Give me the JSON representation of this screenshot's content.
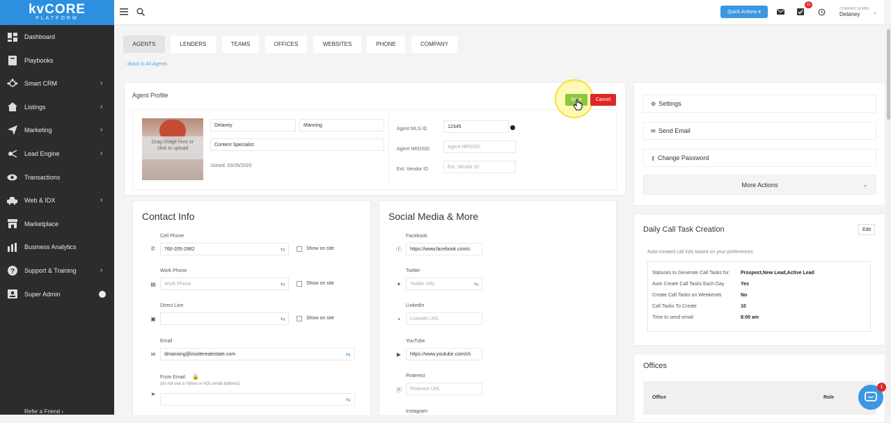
{
  "brand": {
    "line1": "kvCORE",
    "line2": "PLATFORM"
  },
  "sidebar": {
    "items": [
      {
        "label": "Dashboard",
        "icon": "dashboard-icon",
        "chevron": false
      },
      {
        "label": "Playbooks",
        "icon": "book-icon",
        "chevron": false
      },
      {
        "label": "Smart CRM",
        "icon": "crm-icon",
        "chevron": true
      },
      {
        "label": "Listings",
        "icon": "home-icon",
        "chevron": true
      },
      {
        "label": "Marketing",
        "icon": "paper-plane-icon",
        "chevron": true
      },
      {
        "label": "Lead Engine",
        "icon": "lead-engine-icon",
        "chevron": true
      },
      {
        "label": "Transactions",
        "icon": "eye-icon",
        "chevron": false
      },
      {
        "label": "Web & IDX",
        "icon": "car-icon",
        "chevron": true
      },
      {
        "label": "Marketplace",
        "icon": "store-icon",
        "chevron": false
      },
      {
        "label": "Business Analytics",
        "icon": "bar-chart-icon",
        "chevron": false
      },
      {
        "label": "Support & Training",
        "icon": "help-icon",
        "chevron": true
      },
      {
        "label": "Super Admin",
        "icon": "user-card-icon",
        "chevron": false
      }
    ],
    "refer": "Refer a Friend ›"
  },
  "topbar": {
    "quick_actions": "Quick Actions ▾",
    "notif_count": "11",
    "company_label": "COMPANY ADMIN",
    "user": "Delaney"
  },
  "tabs": [
    "AGENTS",
    "LENDERS",
    "TEAMS",
    "OFFICES",
    "WEBSITES",
    "PHONE",
    "COMPANY"
  ],
  "back_link": "‹ Back to All Agents",
  "profile": {
    "title": "Agent Profile",
    "save": "Save",
    "cancel": "Cancel",
    "drag_text": "Drag image here or click to upload",
    "first_name": "Delaney",
    "last_name": "Manning",
    "job_title": "Content Specialist",
    "joined": "Joined: 03/26/2020",
    "mls_label": "Agent MLS ID",
    "mls_value": "12345",
    "nrdsid_label": "Agent NRDSID",
    "nrdsid_placeholder": "Agent NRDSID",
    "vendor_label": "Ext. Vendor ID",
    "vendor_placeholder": "Ext. Vendor ID"
  },
  "contact": {
    "title": "Contact Info",
    "cell_label": "Cell Phone",
    "cell_value": "760-205-2982",
    "work_label": "Work Phone",
    "work_placeholder": "Work Phone",
    "direct_label": "Direct Line",
    "direct_value": "",
    "email_label": "Email",
    "email_value": "dmanning@insiderealestate.com",
    "from_label": "From Email:",
    "from_note": "(do not use a Yahoo or AOL email address)",
    "show_on_site": "Show on site"
  },
  "social": {
    "title": "Social Media & More",
    "facebook_label": "Facebook",
    "facebook_value": "https://www.facebook.com/c",
    "twitter_label": "Twitter",
    "twitter_placeholder": "Twitter URL",
    "linkedin_label": "LinkedIn",
    "linkedin_placeholder": "Linkedin URL",
    "youtube_label": "YouTube",
    "youtube_value": "https://www.youtube.com/ch",
    "pinterest_label": "Pinterest",
    "pinterest_placeholder": "Pinterest URL",
    "instagram_label": "Instagram"
  },
  "actions": {
    "settings": "Settings",
    "send_email": "Send Email",
    "change_password": "Change Password",
    "more_actions": "More Actions"
  },
  "daily_call": {
    "title": "Daily Call Task Creation",
    "edit": "Edit",
    "subtitle": "Auto-created call lists based on your preferences.",
    "rows": [
      {
        "label": "Statuses to Generate Call Tasks for",
        "value": "Prospect,New Lead,Active Lead"
      },
      {
        "label": "Auto Create Call Tasks Each Day",
        "value": "Yes"
      },
      {
        "label": "Create Call Tasks on Weekends",
        "value": "No"
      },
      {
        "label": "Call Tasks To Create",
        "value": "10"
      },
      {
        "label": "Time to send email",
        "value": "8:00 am"
      }
    ]
  },
  "offices": {
    "title": "Offices",
    "col_office": "Office",
    "col_role": "Role"
  },
  "chat": {
    "badge": "1"
  },
  "colors": {
    "brand": "#2d8fe0",
    "save": "#8dc63f",
    "cancel": "#e02626",
    "sidebar": "#2c2c2c"
  }
}
